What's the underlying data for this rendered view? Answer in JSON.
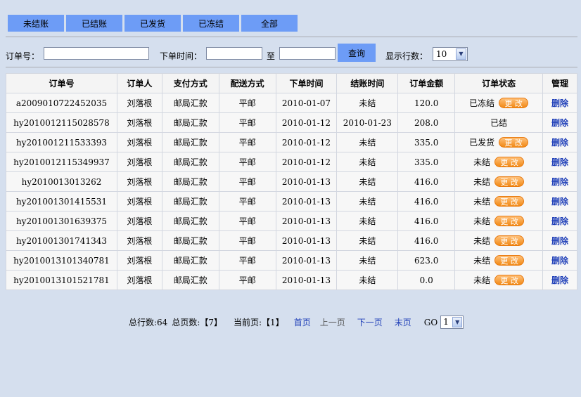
{
  "tabs": [
    "未结账",
    "已结账",
    "已发货",
    "已冻结",
    "全部"
  ],
  "search": {
    "order_no_label": "订单号：",
    "order_no_value": "",
    "order_time_label": "下单时间：",
    "time_from_value": "",
    "to_label": "至",
    "time_to_value": "",
    "query_label": "查询",
    "rows_label": "显示行数：",
    "rows_value": "10"
  },
  "table": {
    "headers": [
      "订单号",
      "订单人",
      "支付方式",
      "配送方式",
      "下单时间",
      "结账时间",
      "订单金额",
      "订单状态",
      "管理"
    ],
    "edit_label": "更 改",
    "delete_label": "删除",
    "rows": [
      {
        "order_no": "a2009010722452035",
        "person": "刘落根",
        "pay": "邮局汇款",
        "ship": "平邮",
        "order_time": "2010-01-07",
        "settle_time": "未结",
        "amount": "120.0",
        "status": "已冻结",
        "editable": true
      },
      {
        "order_no": "hy2010012115028578",
        "person": "刘落根",
        "pay": "邮局汇款",
        "ship": "平邮",
        "order_time": "2010-01-12",
        "settle_time": "2010-01-23",
        "amount": "208.0",
        "status": "已结",
        "editable": false
      },
      {
        "order_no": "hy201001211533393",
        "person": "刘落根",
        "pay": "邮局汇款",
        "ship": "平邮",
        "order_time": "2010-01-12",
        "settle_time": "未结",
        "amount": "335.0",
        "status": "已发货",
        "editable": true
      },
      {
        "order_no": "hy2010012115349937",
        "person": "刘落根",
        "pay": "邮局汇款",
        "ship": "平邮",
        "order_time": "2010-01-12",
        "settle_time": "未结",
        "amount": "335.0",
        "status": "未结",
        "editable": true
      },
      {
        "order_no": "hy2010013013262",
        "person": "刘落根",
        "pay": "邮局汇款",
        "ship": "平邮",
        "order_time": "2010-01-13",
        "settle_time": "未结",
        "amount": "416.0",
        "status": "未结",
        "editable": true
      },
      {
        "order_no": "hy201001301415531",
        "person": "刘落根",
        "pay": "邮局汇款",
        "ship": "平邮",
        "order_time": "2010-01-13",
        "settle_time": "未结",
        "amount": "416.0",
        "status": "未结",
        "editable": true
      },
      {
        "order_no": "hy201001301639375",
        "person": "刘落根",
        "pay": "邮局汇款",
        "ship": "平邮",
        "order_time": "2010-01-13",
        "settle_time": "未结",
        "amount": "416.0",
        "status": "未结",
        "editable": true
      },
      {
        "order_no": "hy201001301741343",
        "person": "刘落根",
        "pay": "邮局汇款",
        "ship": "平邮",
        "order_time": "2010-01-13",
        "settle_time": "未结",
        "amount": "416.0",
        "status": "未结",
        "editable": true
      },
      {
        "order_no": "hy2010013101340781",
        "person": "刘落根",
        "pay": "邮局汇款",
        "ship": "平邮",
        "order_time": "2010-01-13",
        "settle_time": "未结",
        "amount": "623.0",
        "status": "未结",
        "editable": true
      },
      {
        "order_no": "hy2010013101521781",
        "person": "刘落根",
        "pay": "邮局汇款",
        "ship": "平邮",
        "order_time": "2010-01-13",
        "settle_time": "未结",
        "amount": "0.0",
        "status": "未结",
        "editable": true
      }
    ]
  },
  "pager": {
    "total_rows": "总行数:64",
    "total_pages": "总页数:【7】",
    "current_page": "当前页:【1】",
    "first": "首页",
    "prev": "上一页",
    "next": "下一页",
    "last": "末页",
    "go_label": "GO",
    "go_value": "1"
  },
  "colors": {
    "background": "#d5dfee",
    "tab_bg": "#6d9cf6",
    "edit_button": "#f28a16",
    "link": "#1f3fb8"
  }
}
